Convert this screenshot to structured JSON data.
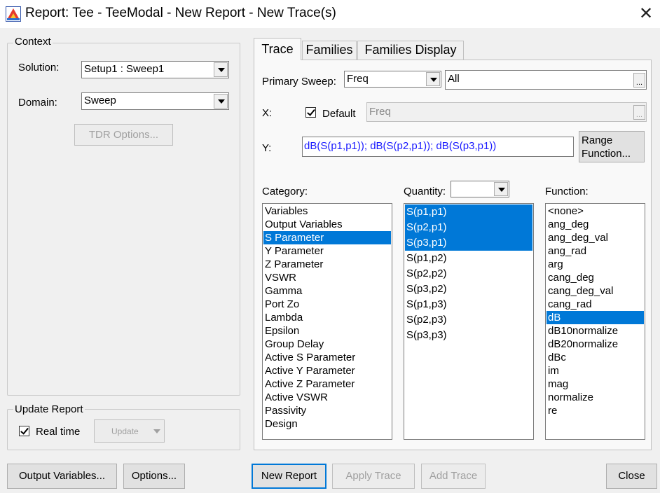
{
  "window": {
    "title": "Report: Tee - TeeModal - New Report - New Trace(s)",
    "close_icon": "close-x-icon"
  },
  "context": {
    "group_label": "Context",
    "solution_label": "Solution:",
    "solution_value": "Setup1 : Sweep1",
    "domain_label": "Domain:",
    "domain_value": "Sweep",
    "tdr_button": "TDR Options..."
  },
  "update_report": {
    "group_label": "Update Report",
    "realtime_label": "Real time",
    "realtime_checked": true,
    "update_button": "Update"
  },
  "tabs": [
    {
      "label": "Trace",
      "active": true
    },
    {
      "label": "Families",
      "active": false
    },
    {
      "label": "Families Display",
      "active": false
    }
  ],
  "trace": {
    "primary_sweep_label": "Primary Sweep:",
    "primary_sweep_value": "Freq",
    "primary_sweep_range": "All",
    "ellipsis": "...",
    "x_label": "X:",
    "x_default_label": "Default",
    "x_default_checked": true,
    "x_value": "Freq",
    "y_label": "Y:",
    "y_value": "dB(S(p1,p1)); dB(S(p2,p1)); dB(S(p3,p1))",
    "range_function_line1": "Range",
    "range_function_line2": "Function...",
    "category_label": "Category:",
    "quantity_label": "Quantity:",
    "function_label": "Function:",
    "categories": [
      {
        "label": "Variables",
        "selected": false
      },
      {
        "label": "Output Variables",
        "selected": false
      },
      {
        "label": "S Parameter",
        "selected": true
      },
      {
        "label": "Y Parameter",
        "selected": false
      },
      {
        "label": "Z Parameter",
        "selected": false
      },
      {
        "label": "VSWR",
        "selected": false
      },
      {
        "label": "Gamma",
        "selected": false
      },
      {
        "label": "Port Zo",
        "selected": false
      },
      {
        "label": "Lambda",
        "selected": false
      },
      {
        "label": "Epsilon",
        "selected": false
      },
      {
        "label": "Group Delay",
        "selected": false
      },
      {
        "label": "Active S Parameter",
        "selected": false
      },
      {
        "label": "Active Y Parameter",
        "selected": false
      },
      {
        "label": "Active Z Parameter",
        "selected": false
      },
      {
        "label": "Active VSWR",
        "selected": false
      },
      {
        "label": "Passivity",
        "selected": false
      },
      {
        "label": "Design",
        "selected": false
      }
    ],
    "quantities": [
      {
        "label": "S(p1,p1)",
        "selected": true
      },
      {
        "label": "S(p2,p1)",
        "selected": true
      },
      {
        "label": "S(p3,p1)",
        "selected": true
      },
      {
        "label": "S(p1,p2)",
        "selected": false
      },
      {
        "label": "S(p2,p2)",
        "selected": false
      },
      {
        "label": "S(p3,p2)",
        "selected": false
      },
      {
        "label": "S(p1,p3)",
        "selected": false
      },
      {
        "label": "S(p2,p3)",
        "selected": false
      },
      {
        "label": "S(p3,p3)",
        "selected": false
      }
    ],
    "functions": [
      {
        "label": "<none>",
        "selected": false
      },
      {
        "label": "ang_deg",
        "selected": false
      },
      {
        "label": "ang_deg_val",
        "selected": false
      },
      {
        "label": "ang_rad",
        "selected": false
      },
      {
        "label": "arg",
        "selected": false
      },
      {
        "label": "cang_deg",
        "selected": false
      },
      {
        "label": "cang_deg_val",
        "selected": false
      },
      {
        "label": "cang_rad",
        "selected": false
      },
      {
        "label": "dB",
        "selected": true
      },
      {
        "label": "dB10normalize",
        "selected": false
      },
      {
        "label": "dB20normalize",
        "selected": false
      },
      {
        "label": "dBc",
        "selected": false
      },
      {
        "label": "im",
        "selected": false
      },
      {
        "label": "mag",
        "selected": false
      },
      {
        "label": "normalize",
        "selected": false
      },
      {
        "label": "re",
        "selected": false
      }
    ]
  },
  "bottom_buttons": {
    "output_variables": "Output Variables...",
    "options": "Options...",
    "new_report": "New Report",
    "apply_trace": "Apply Trace",
    "add_trace": "Add Trace",
    "close": "Close"
  },
  "colors": {
    "selection": "#0078d7",
    "y_text": "#1a1aff",
    "window_bg": "#f0f0f0"
  }
}
